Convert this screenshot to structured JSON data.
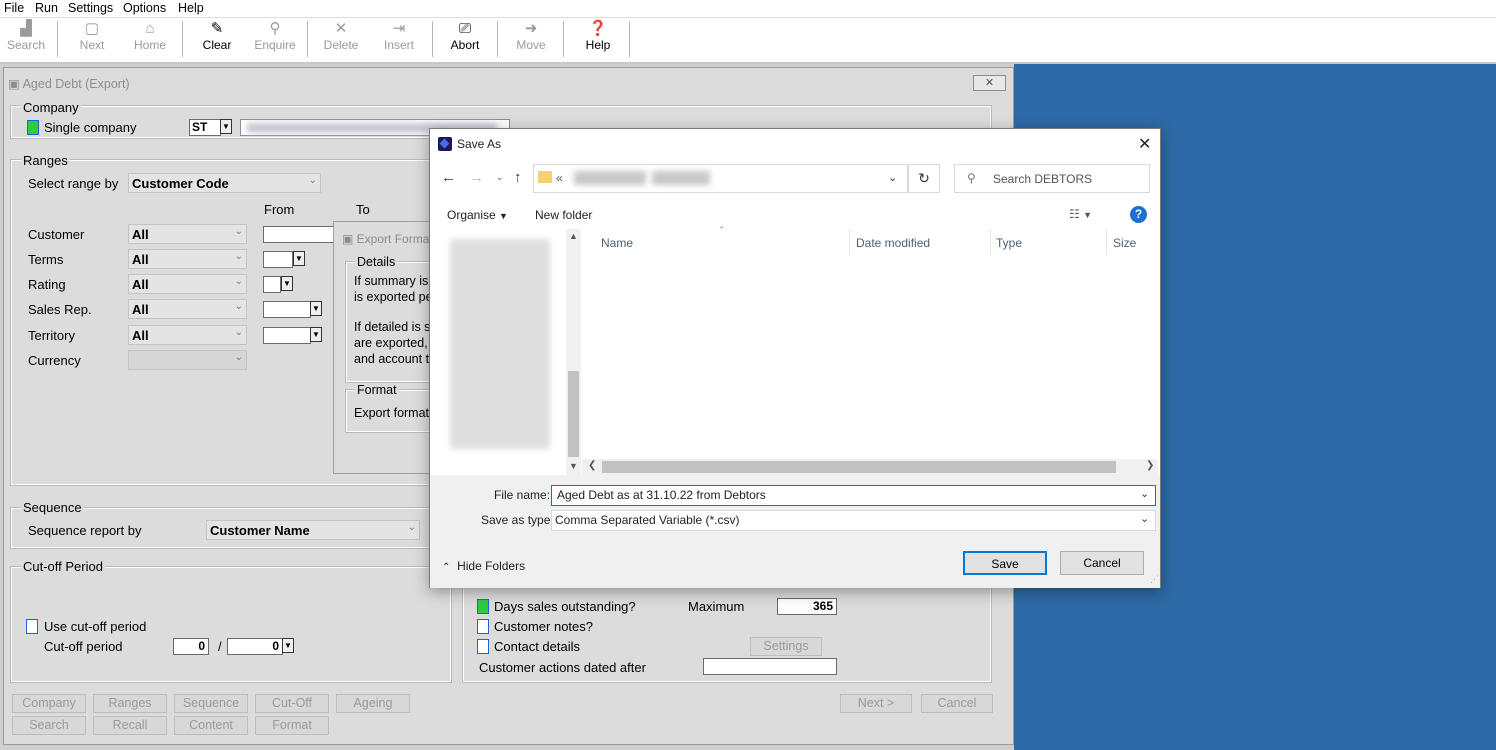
{
  "menu": [
    "File",
    "Run",
    "Settings",
    "Options",
    "Help"
  ],
  "toolbar": {
    "search": "Search",
    "next": "Next",
    "home": "Home",
    "clear": "Clear",
    "enquire": "Enquire",
    "delete": "Delete",
    "insert": "Insert",
    "abort": "Abort",
    "move": "Move",
    "help": "Help"
  },
  "window": {
    "title": "Aged Debt  (Export)"
  },
  "company": {
    "heading": "Company",
    "single_company": "Single company",
    "code": "ST"
  },
  "ranges": {
    "heading": "Ranges",
    "select_range_by": "Select range by",
    "select_value": "Customer Code",
    "from": "From",
    "to": "To",
    "rows": [
      {
        "label": "Customer",
        "value": "All"
      },
      {
        "label": "Terms",
        "value": "All"
      },
      {
        "label": "Rating",
        "value": "All"
      },
      {
        "label": "Sales Rep.",
        "value": "All"
      },
      {
        "label": "Territory",
        "value": "All"
      },
      {
        "label": "Currency",
        "value": ""
      }
    ]
  },
  "export_format": {
    "title": "Export Forma",
    "details_heading": "Details",
    "line1": "If summary is",
    "line2": "is exported pe",
    "line3": "If detailed is s",
    "line4": "are exported,",
    "line5": "and account t",
    "format_heading": "Format",
    "export_format_label": "Export format"
  },
  "sequence": {
    "heading": "Sequence",
    "report_by": "Sequence report by",
    "value": "Customer Name"
  },
  "cutoff": {
    "heading": "Cut-off Period",
    "use": "Use cut-off period",
    "period": "Cut-off period",
    "v1": "0",
    "slash": "/",
    "v2": "0"
  },
  "options": {
    "dso": "Days sales outstanding?",
    "maximum": "Maximum",
    "max_value": "365",
    "notes": "Customer notes?",
    "contact": "Contact details",
    "settings": "Settings",
    "actions_after": "Customer actions dated after"
  },
  "bottom_buttons": {
    "row1": [
      "Company",
      "Ranges",
      "Sequence",
      "Cut-Off",
      "Ageing"
    ],
    "row2": [
      "Search",
      "Recall",
      "Content",
      "Format"
    ],
    "next": "Next >",
    "cancel": "Cancel"
  },
  "saveas": {
    "title": "Save As",
    "path_prefix": "«",
    "search_placeholder": "Search DEBTORS",
    "organise": "Organise",
    "new_folder": "New folder",
    "columns": [
      "Name",
      "Date modified",
      "Type",
      "Size"
    ],
    "file_name_label": "File name:",
    "file_name": "Aged Debt as at 31.10.22 from Debtors",
    "save_type_label": "Save as type:",
    "save_type": "Comma Separated Variable (*.csv)",
    "hide_folders": "Hide Folders",
    "save": "Save",
    "cancel": "Cancel"
  },
  "colors": {
    "desktop": "#2e6aa6",
    "check_on": "#2ecc40",
    "help_blue": "#1d6fd1"
  }
}
